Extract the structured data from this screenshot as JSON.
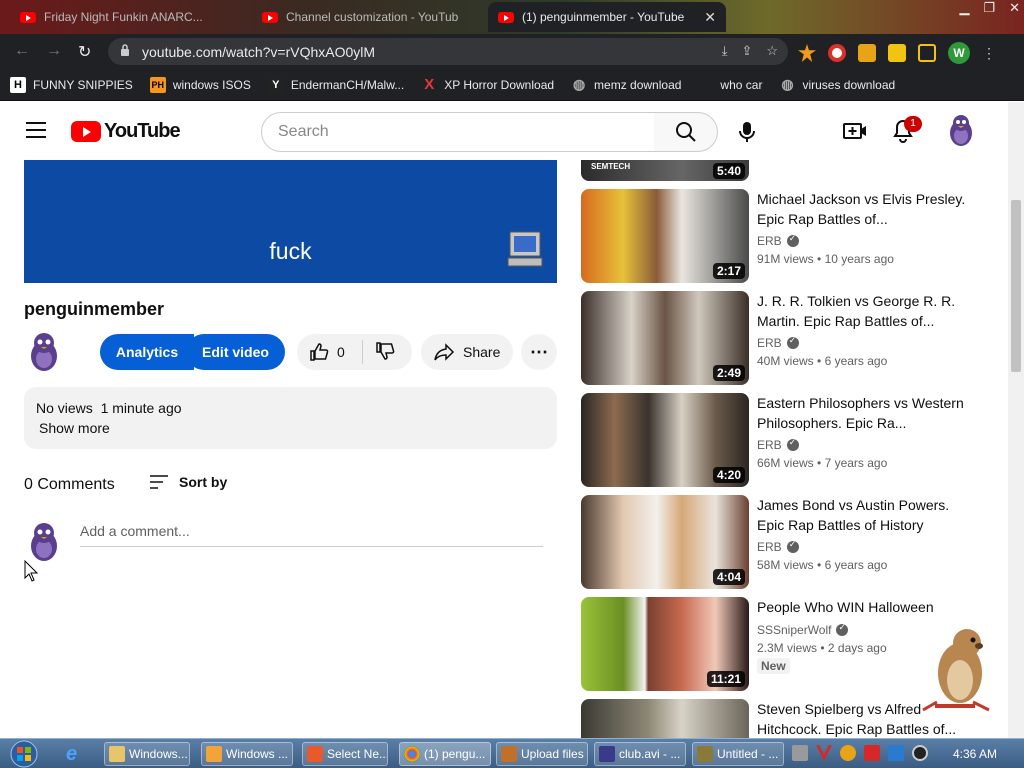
{
  "browser": {
    "tabs": [
      {
        "label": "Friday Night Funkin ANARC...",
        "active": false
      },
      {
        "label": "Channel customization - YouTub",
        "active": false
      },
      {
        "label": "(1) penguinmember - YouTube",
        "active": true
      }
    ],
    "url": "youtube.com/watch?v=rVQhxAO0ylM",
    "profile_initial": "W"
  },
  "bookmarks": [
    {
      "label": "FUNNY SNIPPIES",
      "icon": "H"
    },
    {
      "label": "windows ISOS",
      "icon": "PH"
    },
    {
      "label": "EndermanCH/Malw...",
      "icon": "Y"
    },
    {
      "label": "XP Horror Download",
      "icon": "X"
    },
    {
      "label": "memz download",
      "icon": "globe"
    },
    {
      "label": "who car",
      "icon": ""
    },
    {
      "label": "viruses download",
      "icon": "globe"
    }
  ],
  "youtube": {
    "logo_text": "YouTube",
    "search_placeholder": "Search",
    "notification_count": "1"
  },
  "video": {
    "overlay_text": "fuck",
    "title": "penguinmember",
    "analytics_label": "Analytics",
    "edit_label": "Edit video",
    "like_count": "0",
    "share_label": "Share",
    "views": "No views",
    "uploaded": "1 minute ago",
    "show_more": "Show more",
    "comments_count": "0 Comments",
    "sort_by": "Sort by",
    "add_comment_placeholder": "Add a comment..."
  },
  "recommendations": [
    {
      "title": "Michael Jackson vs Elvis Presley. Epic Rap Battles of...",
      "channel": "ERB",
      "views": "91M views",
      "age": "10 years ago",
      "duration": "2:17",
      "new": false
    },
    {
      "title": "J. R. R. Tolkien vs George R. R. Martin. Epic Rap Battles of...",
      "channel": "ERB",
      "views": "40M views",
      "age": "6 years ago",
      "duration": "2:49",
      "new": false
    },
    {
      "title": "Eastern Philosophers vs Western Philosophers. Epic Ra...",
      "channel": "ERB",
      "views": "66M views",
      "age": "7 years ago",
      "duration": "4:20",
      "new": false
    },
    {
      "title": "James Bond vs Austin Powers. Epic Rap Battles of History",
      "channel": "ERB",
      "views": "58M views",
      "age": "6 years ago",
      "duration": "4:04",
      "new": false
    },
    {
      "title": "People Who WIN Halloween",
      "channel": "SSSniperWolf",
      "views": "2.3M views",
      "age": "2 days ago",
      "duration": "11:21",
      "new": true,
      "new_label": "New"
    },
    {
      "title": "Steven Spielberg vs Alfred Hitchcock. Epic Rap Battles of...",
      "channel": "",
      "views": "",
      "age": "",
      "duration": "",
      "new": false
    }
  ],
  "partial_top_duration": "5:40",
  "partial_top_thumb_text": "SEMTECH",
  "taskbar": {
    "buttons": [
      "Windows...",
      "Windows ...",
      "Select Ne...",
      "(1) pengu...",
      "Upload files",
      "club.avi - ...",
      "Untitled - ..."
    ],
    "time": "4:36 AM"
  }
}
